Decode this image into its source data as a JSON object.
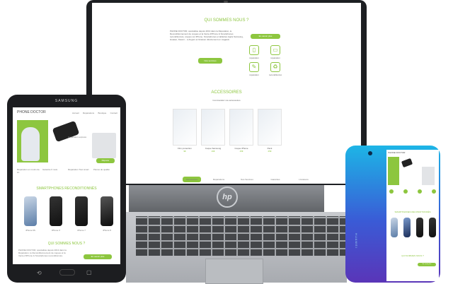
{
  "laptop": {
    "section_title": "QUI SOMMES NOUS ?",
    "intro_text": "PHONE DOCTOR, spécialiste depuis 2013 dans la Réparation, le Reconditionnement de coques et la Vente d'iPhone & Smartphones reconditionnés, coques sur iPhone, Smartphones et tablettes Apple Samsung, Huawei, Xiaomi... à Angers et livraison directement en magasin.",
    "button_label": "En savoir plus",
    "button_label_2": "Nos services",
    "features": [
      {
        "icon": "phone-icon",
        "label": "réparation"
      },
      {
        "icon": "tablet-icon",
        "label": "réparation"
      },
      {
        "icon": "wrench-icon",
        "label": "réparation"
      },
      {
        "icon": "recycle-icon",
        "label": "reconditionné"
      }
    ],
    "accessories_title": "ACCESSOIRES",
    "accessories_sub": "Commandez vos accessoires",
    "products": [
      {
        "name": "Film protection",
        "price": "9€"
      },
      {
        "name": "Coque Samsung",
        "price": "19€"
      },
      {
        "name": "Coque iPhone",
        "price": "15€"
      },
      {
        "name": "Pack",
        "price": "25€"
      }
    ],
    "tabs": [
      "Accessoires",
      "Réparations",
      "Nos Services",
      "Garanties",
      "Livraisons"
    ]
  },
  "tablet": {
    "brand": "SAMSUNG",
    "logo": "PHONE DOCTOR",
    "nav": [
      "Accueil",
      "Réparations",
      "Boutique",
      "Contact"
    ],
    "hero_title": "Réparation express",
    "hero_cta": "Réparer",
    "services": [
      "Réparation en moins de 1h",
      "Garantie 6 mois",
      "Réparation Tout smart",
      "Pièces de qualité"
    ],
    "section_title": "SMARTPHONES RECONDITIONNÉS",
    "phones": [
      {
        "name": "iPhone 6S"
      },
      {
        "name": "iPhone X"
      },
      {
        "name": "iPhone 7"
      },
      {
        "name": "iPhone 8"
      }
    ],
    "about_title": "QUI SOMMES NOUS ?",
    "about_text": "PHONE DOCTOR, spécialiste depuis 2013 dans la Réparation, le Reconditionnement de coques et la Vente d'iPhone & Smartphones reconditionnés.",
    "about_button": "En savoir plus"
  },
  "phone": {
    "brand": "HUAWEI",
    "logo": "PHONE DOCTOR",
    "section_title": "SMARTPHONES RECONDITIONNÉS",
    "about_title": "QUI SOMMES NOUS ?",
    "button_label": "En savoir plus"
  },
  "colors": {
    "accent": "#8dc63f",
    "laptop_frame": "#1d1f22",
    "tablet_frame": "#1c1d20",
    "phone_gradient_top": "#1db5e6",
    "phone_gradient_bottom": "#5a35b8"
  }
}
